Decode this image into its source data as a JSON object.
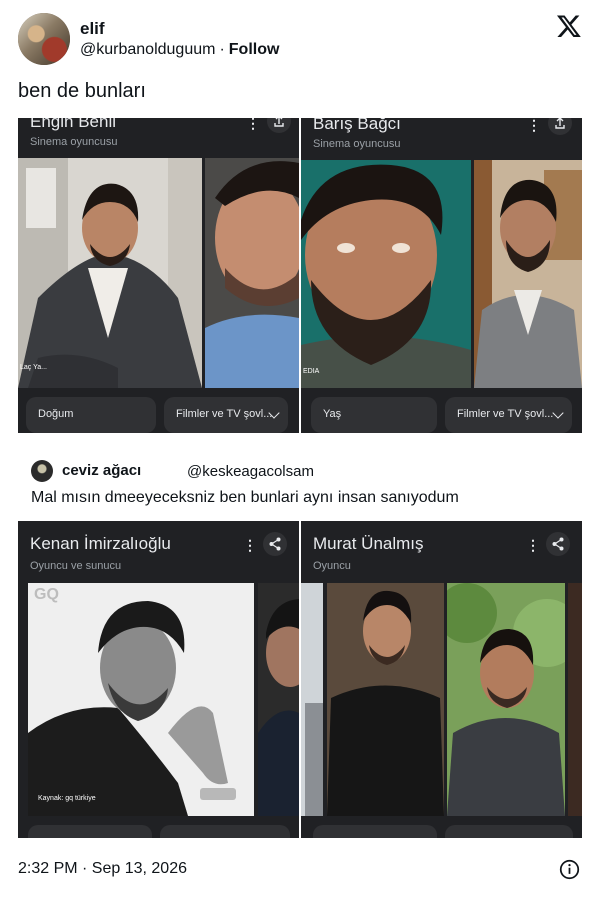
{
  "tweet": {
    "display_name": "elif",
    "handle": "@kurbanolduguum",
    "separator": "·",
    "follow_label": "Follow",
    "text": "ben de bunları",
    "timestamp": "2:32 PM · Sep 13, 2026"
  },
  "panels_top": [
    {
      "title": "Engin Benli",
      "subtitle": "Sinema oyuncusu",
      "chip_left": "Doğum",
      "chip_right": "Filmler ve TV şovl...",
      "photo_caption": "Laç Ya..."
    },
    {
      "title": "Barış Bağcı",
      "subtitle": "Sinema oyuncusu",
      "chip_left": "Yaş",
      "chip_right": "Filmler ve TV şovl...",
      "photo_caption": "EDIA"
    }
  ],
  "quote": {
    "display_name": "ceviz ağacı",
    "handle": "@keskeagacolsam",
    "text": "Mal mısın dmeeyeceksniz ben bunlari aynı insan sanıyodum"
  },
  "panels_bottom": [
    {
      "title": "Kenan İmirzalıoğlu",
      "subtitle": "Oyuncu ve sunucu",
      "watermark": "GQ",
      "photo_caption": "Kaynak: gq türkiye"
    },
    {
      "title": "Murat Ünalmış",
      "subtitle": "Oyuncu"
    }
  ],
  "colors": {
    "panel_bg": "#202124",
    "chip_bg": "#303134",
    "text": "#0f1419"
  }
}
